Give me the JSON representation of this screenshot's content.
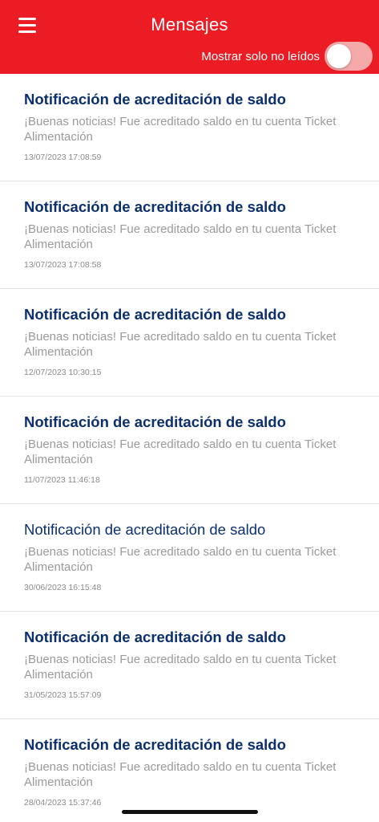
{
  "header": {
    "title": "Mensajes",
    "filter_label": "Mostrar solo no leídos",
    "filter_enabled": false,
    "background_color": "#ec1c24",
    "menu_icon": "hamburger-menu-icon"
  },
  "messages": [
    {
      "title": "Notificación de acreditación de saldo",
      "body": "¡Buenas noticias! Fue acreditado saldo en tu cuenta Ticket Alimentación",
      "date": "13/07/2023 17:08:59",
      "unread": true
    },
    {
      "title": "Notificación de acreditación de saldo",
      "body": "¡Buenas noticias! Fue acreditado saldo en tu cuenta Ticket Alimentación",
      "date": "13/07/2023 17:08:58",
      "unread": true
    },
    {
      "title": "Notificación de acreditación de saldo",
      "body": "¡Buenas noticias! Fue acreditado saldo en tu cuenta Ticket Alimentación",
      "date": "12/07/2023 10:30:15",
      "unread": true
    },
    {
      "title": "Notificación de acreditación de saldo",
      "body": "¡Buenas noticias! Fue acreditado saldo en tu cuenta Ticket Alimentación",
      "date": "11/07/2023 11:46:18",
      "unread": true
    },
    {
      "title": "Notificación de acreditación de saldo",
      "body": "¡Buenas noticias! Fue acreditado saldo en tu cuenta Ticket Alimentación",
      "date": "30/06/2023 16:15:48",
      "unread": false
    },
    {
      "title": "Notificación de acreditación de saldo",
      "body": "¡Buenas noticias! Fue acreditado saldo en tu cuenta Ticket Alimentación",
      "date": "31/05/2023 15:57:09",
      "unread": true
    },
    {
      "title": "Notificación de acreditación de saldo",
      "body": "¡Buenas noticias! Fue acreditado saldo en tu cuenta Ticket Alimentación",
      "date": "28/04/2023 15:37:46",
      "unread": true
    }
  ]
}
